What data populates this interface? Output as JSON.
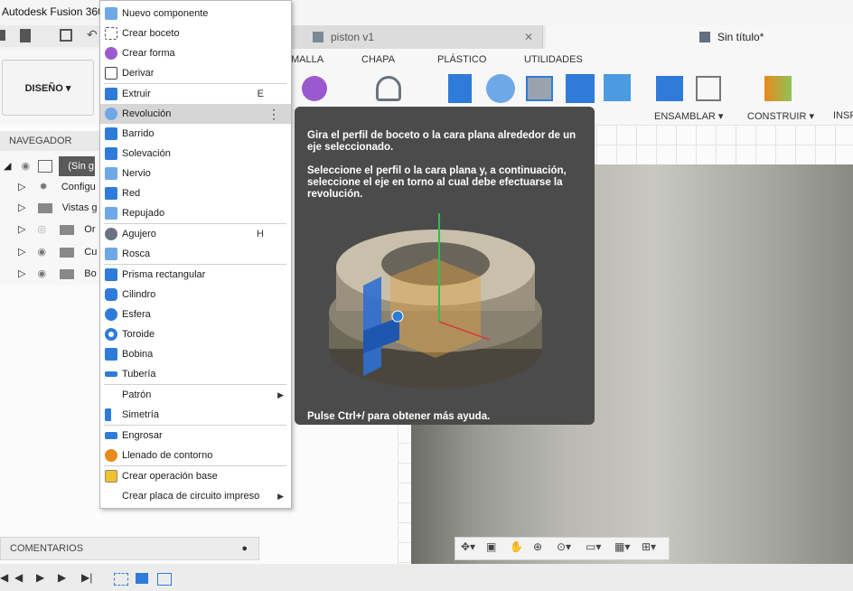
{
  "app": {
    "title": "Autodesk Fusion 360"
  },
  "tabs": [
    {
      "label": "piston v1",
      "close": "✕"
    },
    {
      "label": "Sin título*"
    }
  ],
  "ribbon": {
    "workspace": "DISEÑO ▾",
    "tabs": [
      "MALLA",
      "CHAPA",
      "PLÁSTICO",
      "UTILIDADES"
    ],
    "groups": [
      "ENSAMBLAR ▾",
      "CONSTRUIR ▾",
      "INSPE"
    ]
  },
  "navigator": {
    "title": "NAVEGADOR",
    "rows": [
      {
        "label": "(Sin g"
      },
      {
        "label": "Configu"
      },
      {
        "label": "Vistas g"
      },
      {
        "label": "Or"
      },
      {
        "label": "Cu"
      },
      {
        "label": "Bo"
      }
    ]
  },
  "menu": {
    "items": [
      {
        "label": "Nuevo componente",
        "icon": "new-component-icon",
        "color": "#6fa8e6"
      },
      {
        "label": "Crear boceto",
        "icon": "sketch-icon",
        "color": "#9aa3ad"
      },
      {
        "label": "Crear forma",
        "icon": "form-icon",
        "color": "#9b59d0"
      },
      {
        "label": "Derivar",
        "icon": "derive-icon",
        "color": "#444444"
      },
      {
        "label": "Extruir",
        "shortcut": "E",
        "icon": "extrude-icon",
        "color": "#2f7bd9"
      },
      {
        "label": "Revolución",
        "icon": "revolve-icon",
        "color": "#6fa8e6"
      },
      {
        "label": "Barrido",
        "icon": "sweep-icon",
        "color": "#2f7bd9"
      },
      {
        "label": "Solevación",
        "icon": "loft-icon",
        "color": "#2f7bd9"
      },
      {
        "label": "Nervio",
        "icon": "rib-icon",
        "color": "#6fa8e6"
      },
      {
        "label": "Red",
        "icon": "web-icon",
        "color": "#2f7bd9"
      },
      {
        "label": "Repujado",
        "icon": "emboss-icon",
        "color": "#6fa8e6"
      },
      {
        "label": "Agujero",
        "shortcut": "H",
        "icon": "hole-icon",
        "color": "#6a7480"
      },
      {
        "label": "Rosca",
        "icon": "thread-icon",
        "color": "#6fa8e6"
      },
      {
        "label": "Prisma rectangular",
        "icon": "box-icon",
        "color": "#2f7bd9"
      },
      {
        "label": "Cilindro",
        "icon": "cylinder-icon",
        "color": "#2f7bd9"
      },
      {
        "label": "Esfera",
        "icon": "sphere-icon",
        "color": "#2f7bd9"
      },
      {
        "label": "Toroide",
        "icon": "torus-icon",
        "color": "#2f7bd9"
      },
      {
        "label": "Bobina",
        "icon": "coil-icon",
        "color": "#2f7bd9"
      },
      {
        "label": "Tubería",
        "icon": "pipe-icon",
        "color": "#2f7bd9"
      },
      {
        "label": "Patrón",
        "icon": "",
        "color": ""
      },
      {
        "label": "Simetría",
        "icon": "mirror-icon",
        "color": "#2f7bd9"
      },
      {
        "label": "Engrosar",
        "icon": "thicken-icon",
        "color": "#2f7bd9"
      },
      {
        "label": "Llenado de contorno",
        "icon": "boundary-fill-icon",
        "color": "#e98a1c"
      },
      {
        "label": "Crear operación base",
        "icon": "base-feature-icon",
        "color": "#f2c12e"
      },
      {
        "label": "Crear placa de circuito impreso",
        "icon": "",
        "color": ""
      }
    ]
  },
  "tooltip": {
    "p1": "Gira el perfil de boceto o la cara plana alrededor de un eje seleccionado.",
    "p2": "Seleccione el perfil o la cara plana y, a continuación, seleccione el eje en torno al cual debe efectuarse la revolución.",
    "footer": "Pulse Ctrl+/ para obtener más ayuda."
  },
  "comments": {
    "label": "COMENTARIOS"
  },
  "colors": {
    "menu_highlight": "#d6d6d6",
    "tooltip_bg": "#4b4b4b",
    "accent_blue": "#2f7bd9"
  }
}
